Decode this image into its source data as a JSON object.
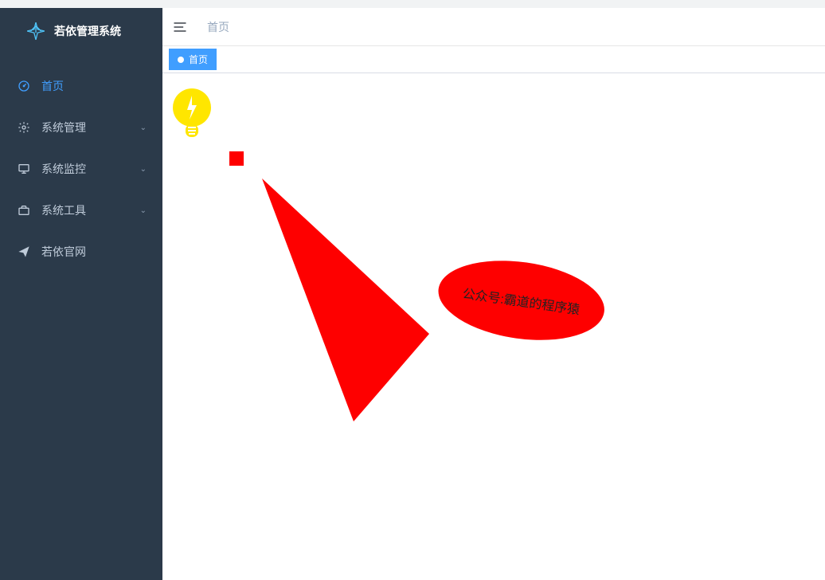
{
  "app": {
    "title": "若依管理系统"
  },
  "sidebar": {
    "items": [
      {
        "label": "首页",
        "active": true,
        "expandable": false
      },
      {
        "label": "系统管理",
        "active": false,
        "expandable": true
      },
      {
        "label": "系统监控",
        "active": false,
        "expandable": true
      },
      {
        "label": "系统工具",
        "active": false,
        "expandable": true
      },
      {
        "label": "若依官网",
        "active": false,
        "expandable": false
      }
    ]
  },
  "breadcrumb": {
    "home": "首页"
  },
  "tabs": {
    "active": {
      "label": "首页"
    }
  },
  "content": {
    "red_square": {
      "color": "#fe0000"
    },
    "annotation_text": "公众号:霸道的程序猿",
    "bulb_color": "#ffe600",
    "red_shape_color": "#fe0000"
  }
}
